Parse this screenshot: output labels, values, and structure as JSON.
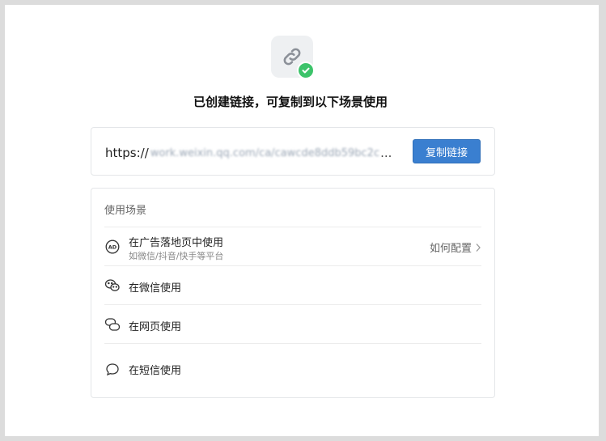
{
  "title": "已创建链接，可复制到以下场景使用",
  "link": {
    "prefix": "https://",
    "blurred": "work.weixin.qq.com/ca/cawcde8ddb59bc2c",
    "ellipsis": "...",
    "copy_label": "复制链接"
  },
  "scenarios": {
    "header": "使用场景",
    "items": [
      {
        "icon": "ad-icon",
        "label": "在广告落地页中使用",
        "sub": "如微信/抖音/快手等平台",
        "action": "如何配置"
      },
      {
        "icon": "wechat-icon",
        "label": "在微信使用"
      },
      {
        "icon": "webpage-icon",
        "label": "在网页使用"
      },
      {
        "icon": "sms-icon",
        "label": "在短信使用"
      }
    ]
  },
  "colors": {
    "accent": "#3a7fd0",
    "success": "#3cc36a",
    "background": "#dcdcdc"
  }
}
